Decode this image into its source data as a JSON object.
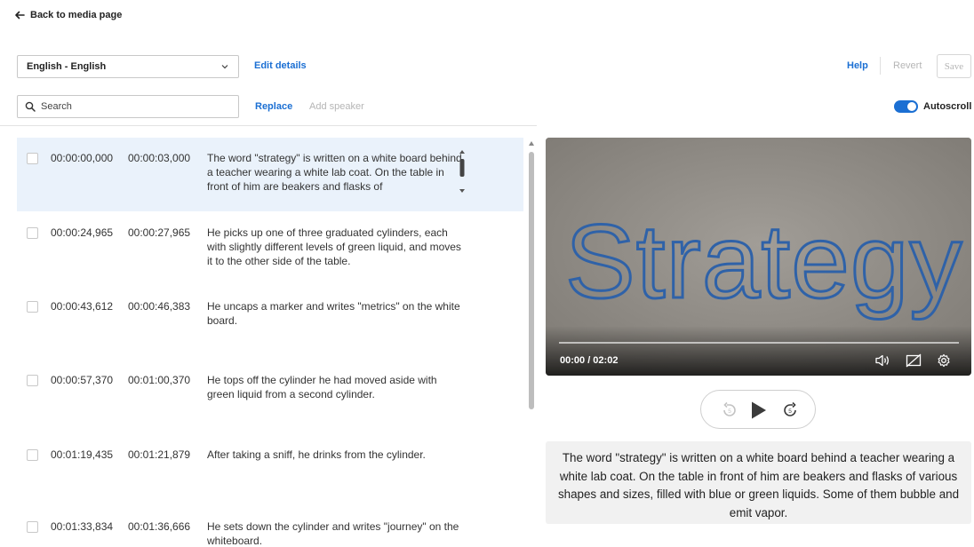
{
  "nav": {
    "back_label": "Back to media page"
  },
  "toolbar": {
    "language": "English - English",
    "edit_details": "Edit details",
    "help": "Help",
    "revert": "Revert",
    "save": "Save",
    "search_placeholder": "Search",
    "replace": "Replace",
    "add_speaker": "Add speaker",
    "autoscroll_label": "Autoscroll",
    "autoscroll_on": true
  },
  "captions": [
    {
      "start": "00:00:00,000",
      "end": "00:00:03,000",
      "text": "The word \"strategy\" is written on a white board behind a teacher wearing a white lab coat. On the table in front of him are beakers and flasks of",
      "active": true
    },
    {
      "start": "00:00:24,965",
      "end": "00:00:27,965",
      "text": "He picks up one of three graduated cylinders, each with slightly different levels of green liquid, and moves it to the other side of the table."
    },
    {
      "start": "00:00:43,612",
      "end": "00:00:46,383",
      "text": "He uncaps a marker and writes \"metrics\" on the white board."
    },
    {
      "start": "00:00:57,370",
      "end": "00:01:00,370",
      "text": "He tops off the cylinder he had moved aside with green liquid from a second cylinder."
    },
    {
      "start": "00:01:19,435",
      "end": "00:01:21,879",
      "text": "After taking a sniff, he drinks from the cylinder."
    },
    {
      "start": "00:01:33,834",
      "end": "00:01:36,666",
      "text": "He sets down the cylinder and writes \"journey\" on the whiteboard."
    }
  ],
  "player": {
    "board_text": "Strategy",
    "time": "00:00 / 02:02",
    "progress": 0,
    "skip_back_seconds": "5",
    "skip_forward_seconds": "5"
  },
  "caption_preview": "The word \"strategy\" is written on a white board behind a teacher wearing a white lab coat. On the table in front of him are beakers and flasks of various shapes and sizes, filled with blue or green liquids. Some of them bubble and emit vapor.",
  "colors": {
    "accent": "#1b6fd3",
    "active_row": "#eaf2fb"
  }
}
